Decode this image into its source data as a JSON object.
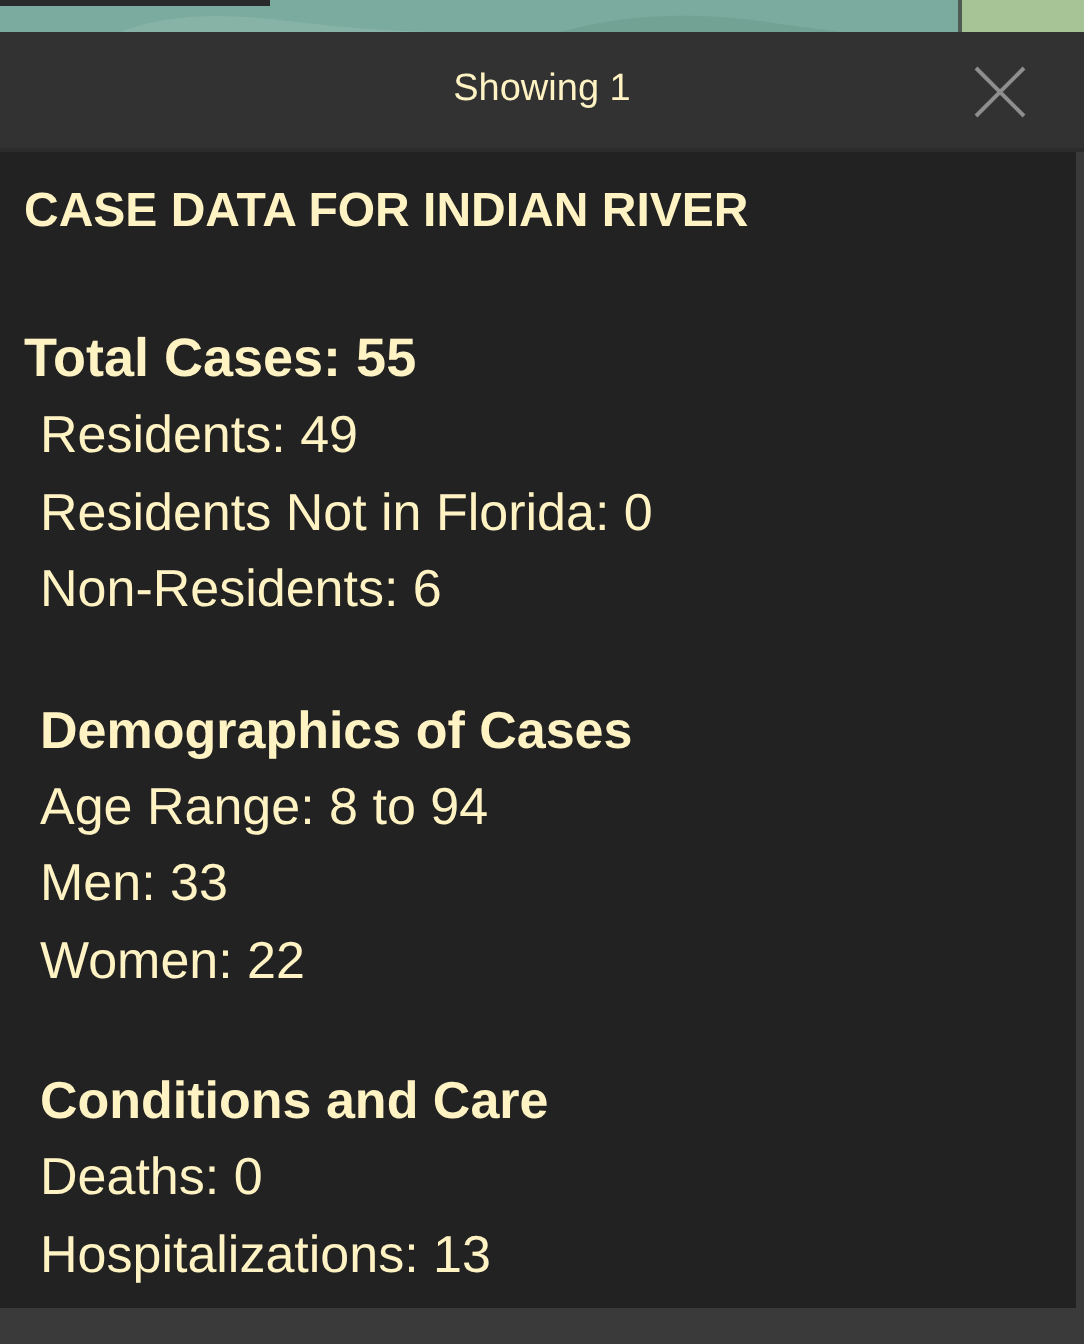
{
  "header": {
    "title": "Showing 1"
  },
  "popup": {
    "title": "CASE DATA FOR INDIAN RIVER",
    "sections": [
      {
        "kind": "total",
        "heading": "Total Cases: 55",
        "lines": [
          "Residents: 49",
          "Residents Not in Florida: 0",
          "Non-Residents: 6"
        ]
      },
      {
        "kind": "group",
        "heading": "Demographics of Cases",
        "lines": [
          "Age Range: 8 to 94",
          "Men: 33",
          "Women: 22"
        ]
      },
      {
        "kind": "group",
        "heading": "Conditions and Care",
        "lines": [
          "Deaths: 0",
          "Hospitalizations: 13"
        ]
      }
    ]
  }
}
